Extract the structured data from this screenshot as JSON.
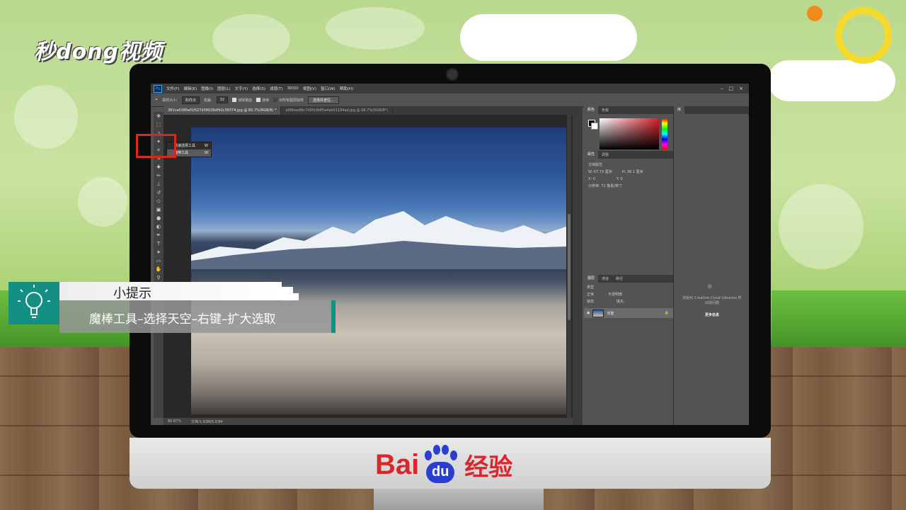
{
  "watermark": {
    "logo_text": "秒dong视频"
  },
  "photoshop": {
    "menu": [
      "文件(F)",
      "编辑(E)",
      "图像(I)",
      "图层(L)",
      "文字(Y)",
      "选择(S)",
      "滤镜(T)",
      "3D(D)",
      "视图(V)",
      "窗口(W)",
      "帮助(H)"
    ],
    "options_bar": {
      "sample_size_label": "取样大小:",
      "sample_size_value": "取样点",
      "tolerance_label": "容差:",
      "tolerance_value": "32",
      "anti_alias_label": "消除锯齿",
      "contiguous_label": "连续",
      "sample_all_layers_label": "对所有图层取样",
      "select_mask_button": "选择并遮住..."
    },
    "tabs": [
      {
        "label": "381ca6380af1f527d58028df92c38374.jpg @ 80.7%(RGB/8) *",
        "active": true
      },
      {
        "label": "a98bae88c7d00c8df5a4ab01184ad.jpg @ 66.7%(RGB/8*)",
        "active": false
      }
    ],
    "tool_flyout": {
      "items": [
        {
          "label": "快速选择工具",
          "shortcut": "W"
        },
        {
          "label": "魔棒工具",
          "shortcut": "W"
        }
      ]
    },
    "status": {
      "zoom": "80.67%",
      "doc": "文档:5.93M/5.93M"
    },
    "color_panel": {
      "tabs": [
        "颜色",
        "色板"
      ],
      "accent": "#d7202a"
    },
    "properties_panel": {
      "tabs": [
        "属性",
        "调整"
      ],
      "title": "文档属性",
      "w": "W: 67.73 厘米",
      "h": "H: 38.1 厘米",
      "x": "X: 0",
      "y": "Y: 0",
      "resolution": "分辨率: 72 像素/英寸"
    },
    "layers_panel": {
      "tabs": [
        "图层",
        "通道",
        "路径"
      ],
      "filter_label": "类型",
      "blend_mode": "正常",
      "opacity_label": "不透明度:",
      "fill_label": "填充:",
      "lock_label": "锁定:",
      "layer_name": "背景"
    },
    "library_panel": {
      "tab": "库",
      "message": "初始化 Creative Cloud Libraries 时出现问题",
      "link": "更多信息"
    }
  },
  "tip": {
    "title": "小提示",
    "text": "魔棒工具–选择天空–右键–扩大选取",
    "accent": "#138f84"
  },
  "brand": {
    "bai": "Bai",
    "du": "du",
    "suffix": "经验",
    "red": "#d9262c",
    "blue": "#2a3fd1"
  }
}
